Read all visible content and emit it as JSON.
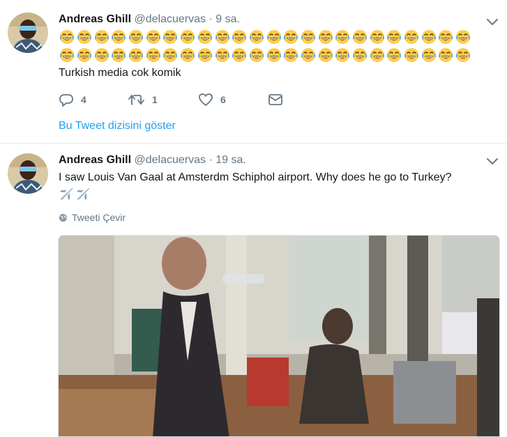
{
  "tweets": [
    {
      "name": "Andreas Ghill",
      "handle": "@delacuervas",
      "separator": "·",
      "time": "9 sa.",
      "emoji_rows": [
        24,
        24
      ],
      "emoji_icon": "tears-of-joy-icon",
      "text": "Turkish media cok komik",
      "actions": {
        "reply_count": "4",
        "retweet_count": "1",
        "like_count": "6"
      },
      "thread_link": "Bu Tweet dizisini göster"
    },
    {
      "name": "Andreas Ghill",
      "handle": "@delacuervas",
      "separator": "·",
      "time": "19 sa.",
      "text": "I saw Louis Van Gaal at Amsterdm Schiphol airport. Why does he go to Turkey?",
      "plane_icon": "airplane-icon",
      "plane_count": 2,
      "translate_label": "Tweeti Çevir"
    }
  ],
  "colors": {
    "link": "#1da1f2",
    "muted": "#657786",
    "text": "#14171a",
    "divider": "#e6ecf0"
  }
}
